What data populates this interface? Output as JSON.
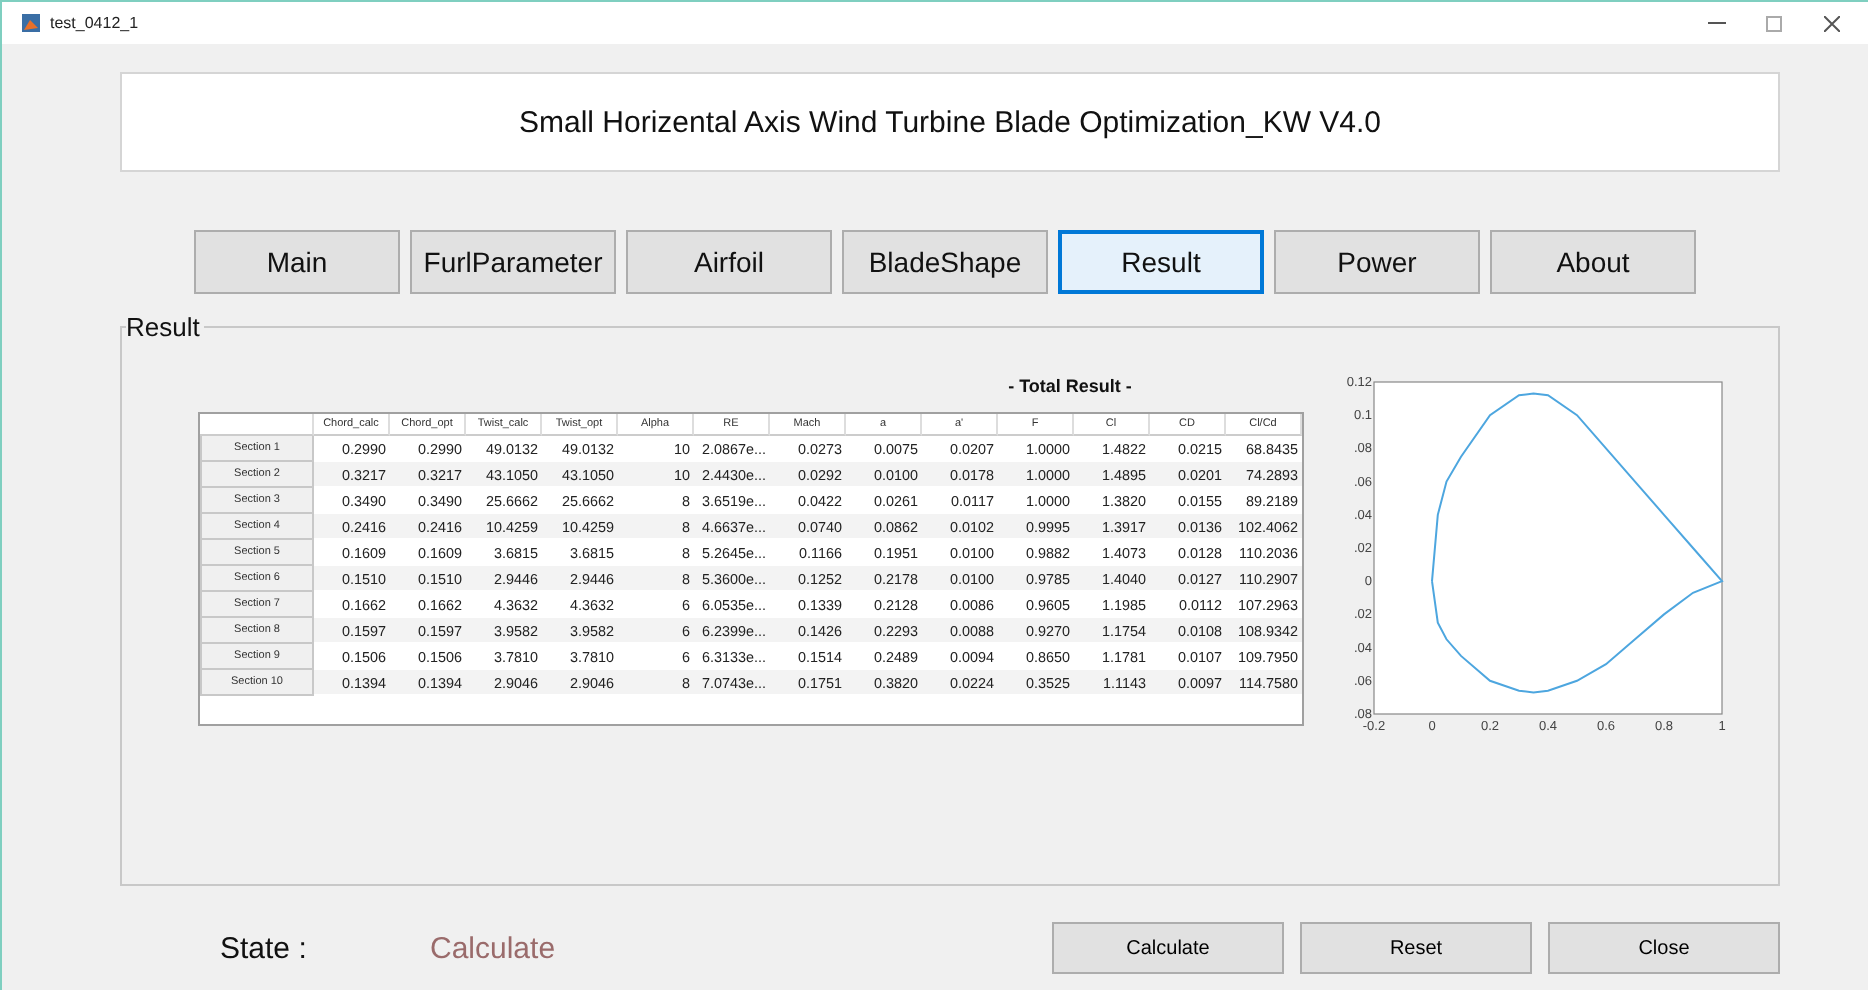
{
  "window": {
    "title": "test_0412_1"
  },
  "app_title": "Small Horizental Axis Wind Turbine Blade Optimization_KW V4.0",
  "tabs": [
    {
      "label": "Main",
      "selected": false
    },
    {
      "label": "FurlParameter",
      "selected": false
    },
    {
      "label": "Airfoil",
      "selected": false
    },
    {
      "label": "BladeShape",
      "selected": false
    },
    {
      "label": "Result",
      "selected": true
    },
    {
      "label": "Power",
      "selected": false
    },
    {
      "label": "About",
      "selected": false
    }
  ],
  "panel": {
    "title": "Result",
    "heading": "- Total Result -",
    "table": {
      "columns": [
        "Chord_calc",
        "Chord_opt",
        "Twist_calc",
        "Twist_opt",
        "Alpha",
        "RE",
        "Mach",
        "a",
        "a'",
        "F",
        "Cl",
        "CD",
        "Cl/Cd"
      ],
      "rows": [
        {
          "label": "Section 1",
          "cells": [
            "0.2990",
            "0.2990",
            "49.0132",
            "49.0132",
            "10",
            "2.0867e...",
            "0.0273",
            "0.0075",
            "0.0207",
            "1.0000",
            "1.4822",
            "0.0215",
            "68.8435"
          ]
        },
        {
          "label": "Section 2",
          "cells": [
            "0.3217",
            "0.3217",
            "43.1050",
            "43.1050",
            "10",
            "2.4430e...",
            "0.0292",
            "0.0100",
            "0.0178",
            "1.0000",
            "1.4895",
            "0.0201",
            "74.2893"
          ]
        },
        {
          "label": "Section 3",
          "cells": [
            "0.3490",
            "0.3490",
            "25.6662",
            "25.6662",
            "8",
            "3.6519e...",
            "0.0422",
            "0.0261",
            "0.0117",
            "1.0000",
            "1.3820",
            "0.0155",
            "89.2189"
          ]
        },
        {
          "label": "Section 4",
          "cells": [
            "0.2416",
            "0.2416",
            "10.4259",
            "10.4259",
            "8",
            "4.6637e...",
            "0.0740",
            "0.0862",
            "0.0102",
            "0.9995",
            "1.3917",
            "0.0136",
            "102.4062"
          ]
        },
        {
          "label": "Section 5",
          "cells": [
            "0.1609",
            "0.1609",
            "3.6815",
            "3.6815",
            "8",
            "5.2645e...",
            "0.1166",
            "0.1951",
            "0.0100",
            "0.9882",
            "1.4073",
            "0.0128",
            "110.2036"
          ]
        },
        {
          "label": "Section 6",
          "cells": [
            "0.1510",
            "0.1510",
            "2.9446",
            "2.9446",
            "8",
            "5.3600e...",
            "0.1252",
            "0.2178",
            "0.0100",
            "0.9785",
            "1.4040",
            "0.0127",
            "110.2907"
          ]
        },
        {
          "label": "Section 7",
          "cells": [
            "0.1662",
            "0.1662",
            "4.3632",
            "4.3632",
            "6",
            "6.0535e...",
            "0.1339",
            "0.2128",
            "0.0086",
            "0.9605",
            "1.1985",
            "0.0112",
            "107.2963"
          ]
        },
        {
          "label": "Section 8",
          "cells": [
            "0.1597",
            "0.1597",
            "3.9582",
            "3.9582",
            "6",
            "6.2399e...",
            "0.1426",
            "0.2293",
            "0.0088",
            "0.9270",
            "1.1754",
            "0.0108",
            "108.9342"
          ]
        },
        {
          "label": "Section 9",
          "cells": [
            "0.1506",
            "0.1506",
            "3.7810",
            "3.7810",
            "6",
            "6.3133e...",
            "0.1514",
            "0.2489",
            "0.0094",
            "0.8650",
            "1.1781",
            "0.0107",
            "109.7950"
          ]
        },
        {
          "label": "Section 10",
          "cells": [
            "0.1394",
            "0.1394",
            "2.9046",
            "2.9046",
            "8",
            "7.0743e...",
            "0.1751",
            "0.3820",
            "0.0224",
            "0.3525",
            "1.1143",
            "0.0097",
            "114.7580"
          ]
        }
      ]
    },
    "plot": {
      "xticks": [
        "-0.2",
        "0",
        "0.2",
        "0.4",
        "0.6",
        "0.8",
        "1"
      ],
      "yticks": [
        "0.12",
        "0.1",
        ".08",
        ".06",
        ".04",
        ".02",
        "0",
        ".02",
        ".04",
        ".06",
        ".08"
      ]
    }
  },
  "state": {
    "label": "State :",
    "value": "Calculate"
  },
  "buttons": [
    "Calculate",
    "Reset",
    "Close"
  ]
}
